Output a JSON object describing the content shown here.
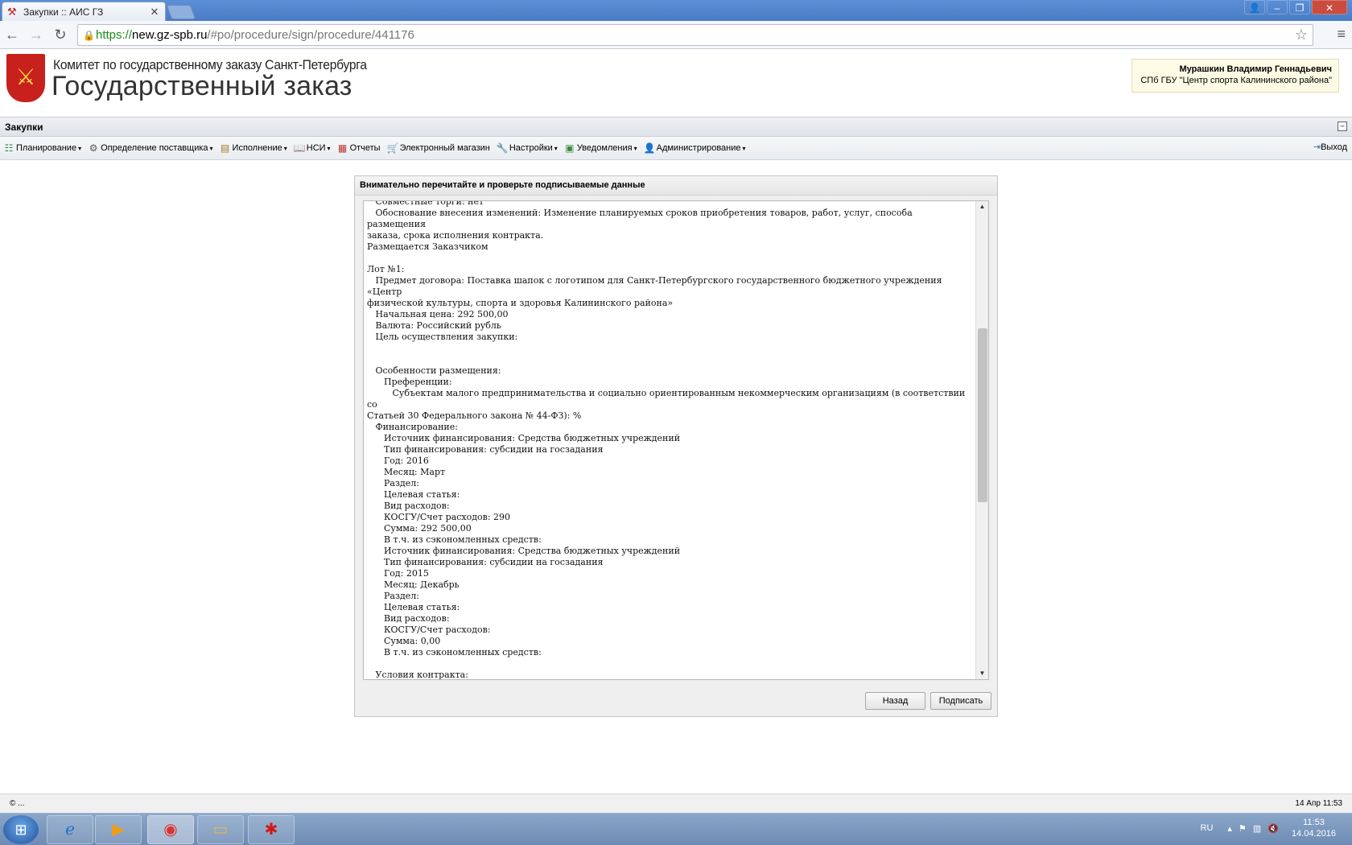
{
  "browser": {
    "tab_title": "Закупки :: АИС ГЗ",
    "url_scheme": "https://",
    "url_host": "new.gz-spb.ru",
    "url_path": "/#po/procedure/sign/procedure/441176"
  },
  "header": {
    "org_line1": "Комитет по государственному заказу Санкт-Петербурга",
    "org_line2": "Государственный заказ",
    "user_name": "Мурашкин Владимир Геннадьевич",
    "user_org": "СПб ГБУ \"Центр спорта Калининского района\""
  },
  "app": {
    "title": "Закупки",
    "menu": [
      {
        "label": "Планирование"
      },
      {
        "label": "Определение поставщика"
      },
      {
        "label": "Исполнение"
      },
      {
        "label": "НСИ"
      },
      {
        "label": "Отчеты"
      },
      {
        "label": "Электронный магазин"
      },
      {
        "label": "Настройки"
      },
      {
        "label": "Уведомления"
      },
      {
        "label": "Администрирование"
      }
    ],
    "exit_label": "Выход"
  },
  "dialog": {
    "title": "Внимательно перечитайте и проверьте подписываемые данные",
    "content": "   Совместные торги: нет\n   Обоснование внесения изменений: Изменение планируемых сроков приобретения товаров, работ, услуг, способа размещения\nзаказа, срока исполнения контракта.\nРазмещается Заказчиком\n\nЛот №1:\n   Предмет договора: Поставка шапок с логотипом для Санкт-Петербургского государственного бюджетного учреждения «Центр\nфизической культуры, спорта и здоровья Калининского района»\n   Начальная цена: 292 500,00\n   Валюта: Российский рубль\n   Цель осуществления закупки:\n\n\n   Особенности размещения:\n      Преференции:\n         Субъектам малого предпринимательства и социально ориентированным некоммерческим организациям (в соответствии со\nСтатьей 30 Федерального закона № 44-ФЗ): %\n   Финансирование:\n      Источник финансирования: Средства бюджетных учреждений\n      Тип финансирования: субсидии на госзадания\n      Год: 2016\n      Месяц: Март\n      Раздел:\n      Целевая статья:\n      Вид расходов:\n      КОСГУ/Счет расходов: 290\n      Сумма: 292 500,00\n      В т.ч. из сэкономленных средств:\n      Источник финансирования: Средства бюджетных учреждений\n      Тип финансирования: субсидии на госзадания\n      Год: 2015\n      Месяц: Декабрь\n      Раздел:\n      Целевая статья:\n      Вид расходов:\n      КОСГУ/Счет расходов:\n      Сумма: 0,00\n      В т.ч. из сэкономленных средств:\n\n   Условия контракта:\n      Срок исполнения контракта: 03.2016\n      Срок подписания победителем государственного контракта, дней: не указано\n      Минимально необходимые требования, предъявляемые к предмету контракта: В соответствии с условиями договора.",
    "back_label": "Назад",
    "sign_label": "Подписать"
  },
  "status": {
    "left": "© ...",
    "right": "14 Апр 11:53"
  },
  "taskbar": {
    "lang": "RU",
    "time": "11:53",
    "date": "14.04.2016"
  }
}
